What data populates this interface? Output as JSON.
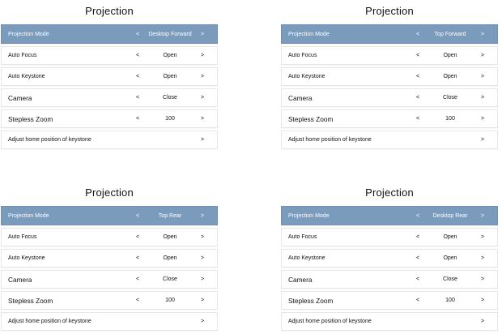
{
  "panels": [
    {
      "title": "Projection",
      "rows": [
        {
          "label": "Projection Mode",
          "value": "Desktop Forward"
        },
        {
          "label": "Auto Focus",
          "value": "Open"
        },
        {
          "label": "Auto Keystone",
          "value": "Open"
        },
        {
          "label": "Camera",
          "value": "Close"
        },
        {
          "label": "Stepless Zoom",
          "value": "100"
        },
        {
          "label": "Adjust home position of keystone",
          "value": ""
        }
      ]
    },
    {
      "title": "Projection",
      "rows": [
        {
          "label": "Projection Mode",
          "value": "Top Forward"
        },
        {
          "label": "Auto Focus",
          "value": "Open"
        },
        {
          "label": "Auto Keystone",
          "value": "Open"
        },
        {
          "label": "Camera",
          "value": "Close"
        },
        {
          "label": "Stepless Zoom",
          "value": "100"
        },
        {
          "label": "Adjust home position of keystone",
          "value": ""
        }
      ]
    },
    {
      "title": "Projection",
      "rows": [
        {
          "label": "Projection Mode",
          "value": "Top Rear"
        },
        {
          "label": "Auto Focus",
          "value": "Open"
        },
        {
          "label": "Auto Keystone",
          "value": "Open"
        },
        {
          "label": "Camera",
          "value": "Close"
        },
        {
          "label": "Stepless Zoom",
          "value": "100"
        },
        {
          "label": "Adjust home position of keystone",
          "value": ""
        }
      ]
    },
    {
      "title": "Projection",
      "rows": [
        {
          "label": "Projection Mode",
          "value": "Desktop Rear"
        },
        {
          "label": "Auto Focus",
          "value": "Open"
        },
        {
          "label": "Auto Keystone",
          "value": "Open"
        },
        {
          "label": "Camera",
          "value": "Close"
        },
        {
          "label": "Stepless Zoom",
          "value": "100"
        },
        {
          "label": "Adjust home position of keystone",
          "value": ""
        }
      ]
    }
  ],
  "glyphs": {
    "left": "<",
    "right": ">"
  },
  "colors": {
    "header_bg": "#7b9bbd",
    "header_text": "#ffffff",
    "row_border": "#e6e6e6"
  }
}
